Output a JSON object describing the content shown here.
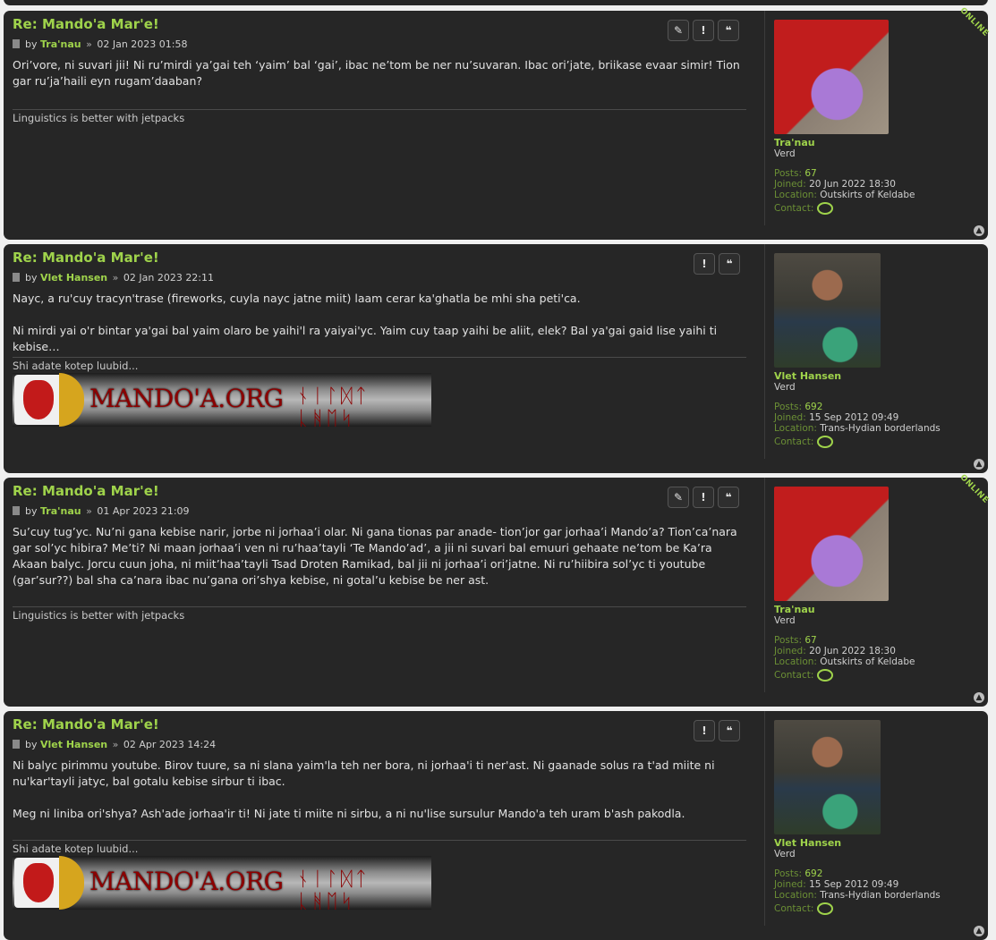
{
  "posts": [
    {
      "title": "Re: Mando'a Mar'e!",
      "by": "by",
      "author": "Tra'nau",
      "sep": "»",
      "date": "02 Jan 2023 01:58",
      "paragraphs": [
        "Ori’vore, ni suvari jii! Ni ru’mirdi ya’gai teh ‘yaim’ bal ‘gai’, ibac ne’tom be ner nu’suvaran. Ibac ori’jate, briikase evaar simir! Tion gar ru’ja’haili eyn rugam’daaban?"
      ],
      "signature": "Linguistics is better with jetpacks",
      "profile": {
        "name": "Tra'nau",
        "rank": "Verd",
        "posts_label": "Posts:",
        "posts": "67",
        "joined_label": "Joined:",
        "joined": "20 Jun 2022 18:30",
        "location_label": "Location:",
        "location": "Outskirts of Keldabe",
        "contact_label": "Contact:",
        "online": "ONLINE"
      }
    },
    {
      "title": "Re: Mando'a Mar'e!",
      "by": "by",
      "author": "Vlet Hansen",
      "sep": "»",
      "date": "02 Jan 2023 22:11",
      "paragraphs": [
        "Nayc, a ru'cuy tracyn'trase (fireworks, cuyla nayc jatne miit) laam cerar ka'ghatla be mhi sha peti'ca.",
        "Ni mirdi yai o'r bintar ya'gai bal yaim olaro be yaihi'l ra yaiyai'yc. Yaim cuy taap yaihi be aliit, elek? Bal ya'gai gaid lise yaihi ti kebise…"
      ],
      "signature": "Shi adate kotep luubid...",
      "banner_text": "MANDO'A.ORG",
      "banner_runes": "ᚾᛁᛚᛞᛏ ᚳᚻᛖᛋ",
      "profile": {
        "name": "Vlet Hansen",
        "rank": "Verd",
        "posts_label": "Posts:",
        "posts": "692",
        "joined_label": "Joined:",
        "joined": "15 Sep 2012 09:49",
        "location_label": "Location:",
        "location": "Trans-Hydian borderlands",
        "contact_label": "Contact:"
      }
    },
    {
      "title": "Re: Mando'a Mar'e!",
      "by": "by",
      "author": "Tra'nau",
      "sep": "»",
      "date": "01 Apr 2023 21:09",
      "paragraphs": [
        "Su’cuy tug’yc. Nu’ni gana kebise narir, jorbe ni jorhaa’i olar. Ni gana tionas par anade- tion’jor gar jorhaa’i Mando’a? Tion’ca’nara gar sol’yc hibira? Me’ti? Ni maan jorhaa’i ven ni ru’haa’tayli ‘Te Mando’ad’, a jii ni suvari bal emuuri gehaate ne’tom be Ka’ra Akaan balyc. Jorcu cuun joha, ni miit’haa’tayli Tsad Droten Ramikad, bal jii ni jorhaa’i ori’jatne. Ni ru’hiibira sol’yc ti youtube (gar’sur??) bal sha ca’nara ibac nu’gana ori’shya kebise, ni gotal’u kebise be ner ast."
      ],
      "signature": "Linguistics is better with jetpacks",
      "profile": {
        "name": "Tra'nau",
        "rank": "Verd",
        "posts_label": "Posts:",
        "posts": "67",
        "joined_label": "Joined:",
        "joined": "20 Jun 2022 18:30",
        "location_label": "Location:",
        "location": "Outskirts of Keldabe",
        "contact_label": "Contact:",
        "online": "ONLINE"
      }
    },
    {
      "title": "Re: Mando'a Mar'e!",
      "by": "by",
      "author": "Vlet Hansen",
      "sep": "»",
      "date": "02 Apr 2023 14:24",
      "paragraphs": [
        "Ni balyc pirimmu youtube. Birov tuure, sa ni slana yaim'la teh ner bora, ni jorhaa'i ti ner'ast. Ni gaanade solus ra t'ad miite ni nu'kar'tayli jatyc, bal gotalu kebise sirbur ti ibac.",
        "Meg ni liniba ori'shya? Ash'ade jorhaa'ir ti! Ni jate ti miite ni sirbu, a ni nu'lise sursulur Mando'a teh uram b'ash pakodla."
      ],
      "signature": "Shi adate kotep luubid...",
      "banner_text": "MANDO'A.ORG",
      "banner_runes": "ᚾᛁᛚᛞᛏ ᚳᚻᛖᛋ",
      "profile": {
        "name": "Vlet Hansen",
        "rank": "Verd",
        "posts_label": "Posts:",
        "posts": "692",
        "joined_label": "Joined:",
        "joined": "15 Sep 2012 09:49",
        "location_label": "Location:",
        "location": "Trans-Hydian borderlands",
        "contact_label": "Contact:"
      }
    }
  ],
  "icons": {
    "edit": "pencil-icon",
    "report": "exclamation-icon",
    "quote": "quote-icon",
    "top": "back-to-top-icon",
    "contact": "speech-bubble-icon",
    "post": "post-document-icon"
  },
  "colors": {
    "accent": "#9fd34b",
    "panel": "#262626",
    "page": "#f0f0f0"
  }
}
